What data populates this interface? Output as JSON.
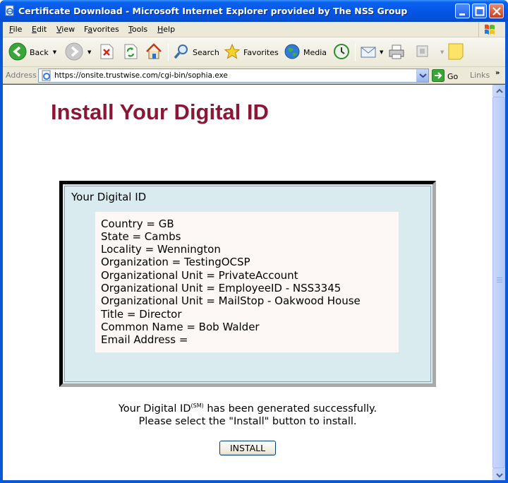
{
  "window": {
    "title": "Certificate Download - Microsoft Internet Explorer provided by The NSS Group"
  },
  "menu": [
    {
      "label": "File",
      "accel": "F",
      "rest": "ile"
    },
    {
      "label": "Edit",
      "accel": "E",
      "rest": "dit"
    },
    {
      "label": "View",
      "accel": "V",
      "rest": "iew"
    },
    {
      "label": "Favorites",
      "accel": "a",
      "pre": "F",
      "rest": "vorites"
    },
    {
      "label": "Tools",
      "accel": "T",
      "rest": "ools"
    },
    {
      "label": "Help",
      "accel": "H",
      "rest": "elp"
    }
  ],
  "toolbar": {
    "back_label": "Back",
    "search_label": "Search",
    "favorites_label": "Favorites",
    "media_label": "Media"
  },
  "address": {
    "label": "Address",
    "url": "https://onsite.trustwise.com/cgi-bin/sophia.exe",
    "go_label": "Go",
    "links_label": "Links"
  },
  "page": {
    "title": "Install Your Digital ID",
    "panel_heading": "Your Digital ID",
    "id_fields": [
      "Country = GB",
      "State = Cambs",
      "Locality = Wennington",
      "Organization = TestingOCSP",
      "Organizational Unit = PrivateAccount",
      "Organizational Unit = EmployeeID - NSS3345",
      "Organizational Unit = MailStop - Oakwood House",
      "Title = Director",
      "Common Name = Bob Walder",
      "Email Address ="
    ],
    "message_line1_pre": "Your Digital ID",
    "message_sup": "(SM)",
    "message_line1_post": " has been generated successfully.",
    "message_line2": "Please select the \"Install\" button to install.",
    "install_label": "INSTALL"
  },
  "colors": {
    "title_red": "#8b1737",
    "panel_bg": "#d9ebee",
    "box_bg": "#fdf7f5",
    "xp_blue": "#0a57d8"
  }
}
